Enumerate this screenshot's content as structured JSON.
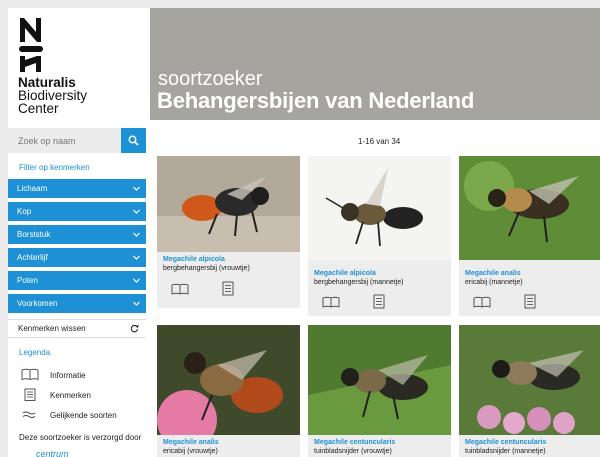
{
  "brand": {
    "line1": "Naturalis",
    "line2": "Biodiversity",
    "line3": "Center"
  },
  "header": {
    "subtitle": "soortzoeker",
    "title": "Behangersbijen van Nederland"
  },
  "search": {
    "placeholder": "Zoek op naam"
  },
  "filters": {
    "title": "Filter op kenmerken",
    "categories": [
      "Lichaam",
      "Kop",
      "Borststuk",
      "Achterlijf",
      "Poten",
      "Voorkomen"
    ],
    "clear_label": "Kenmerken wissen"
  },
  "legend": {
    "title": "Legenda",
    "items": [
      {
        "label": "Informatie",
        "icon": "book-icon"
      },
      {
        "label": "Kenmerken",
        "icon": "traits-icon"
      },
      {
        "label": "Gelijkende soorten",
        "icon": "similar-icon"
      }
    ]
  },
  "credits": {
    "text": "Deze soortzoeker is verzorgd door",
    "partner": "centrum"
  },
  "pager": {
    "text": "1-16 van 34"
  },
  "results": [
    {
      "name": "Megachile alpicola",
      "common": "bergbehangersbij (vrouwtje)"
    },
    {
      "name": "Megachile alpicola",
      "common": "bergbehangersbij (mannetje)"
    },
    {
      "name": "Megachile analis",
      "common": "ericabij (mannetje)"
    },
    {
      "name": "Megachile analis",
      "common": "ericabij (vrouwtje)"
    },
    {
      "name": "Megachile centuncularis",
      "common": "tuinbladsnijder (vrouwtje)"
    },
    {
      "name": "Megachile centuncularis",
      "common": "tuinbladsnijder (mannetje)"
    }
  ],
  "colors": {
    "accent": "#1e90d6",
    "hero": "#a6a49f",
    "card": "#ededed"
  }
}
